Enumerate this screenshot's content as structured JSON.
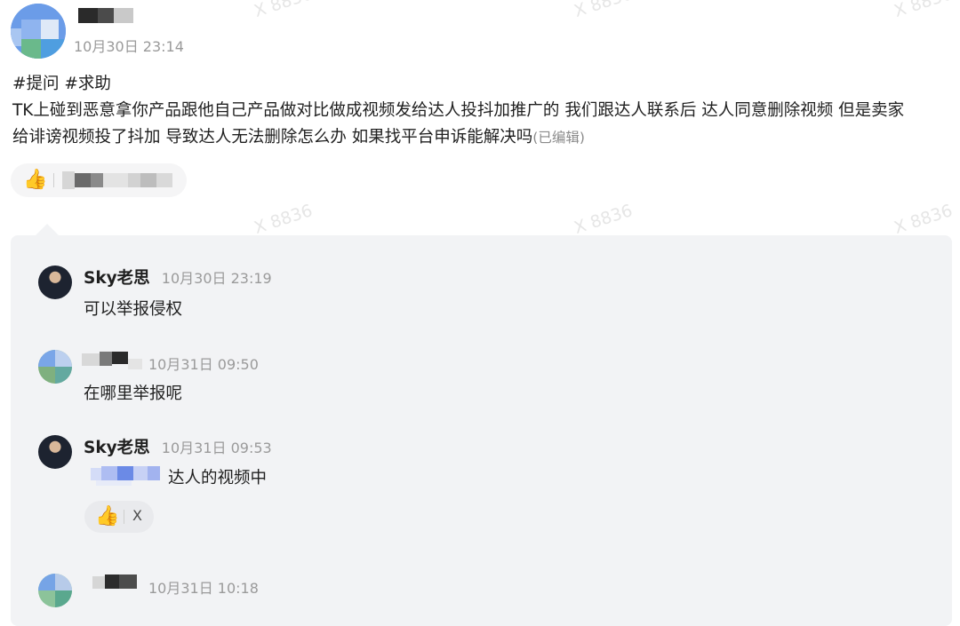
{
  "watermark": "X 8836",
  "post": {
    "author_name": "",
    "timestamp": "10月30日 23:14",
    "hashtags": "#提问 #求助",
    "body": "TK上碰到恶意拿你产品跟他自己产品做对比做成视频发给达人投抖加推广的 我们跟达人联系后 达人同意删除视频 但是卖家给诽谤视频投了抖加 导致达人无法删除怎么办 如果找平台申诉能解决吗",
    "edited_label": "(已编辑)"
  },
  "post_reaction": {
    "icon": "thumbs-up-icon",
    "users": ""
  },
  "comments": [
    {
      "author": "Sky老思",
      "time": "10月30日 23:19",
      "text": "可以举报侵权"
    },
    {
      "author": "",
      "time": "10月31日 09:50",
      "text": "在哪里举报呢"
    },
    {
      "author": "Sky老思",
      "time": "10月31日 09:53",
      "mention": "",
      "text": "达人的视频中",
      "reaction": {
        "icon": "thumbs-up-icon",
        "user": "X"
      }
    },
    {
      "author": "",
      "time": "10月31日 10:18",
      "text": ""
    }
  ],
  "colors": {
    "panel_bg": "#f2f3f5",
    "meta_gray": "#9a9a9a",
    "text": "#1f1f1f",
    "watermark": "#e6e6e6"
  }
}
